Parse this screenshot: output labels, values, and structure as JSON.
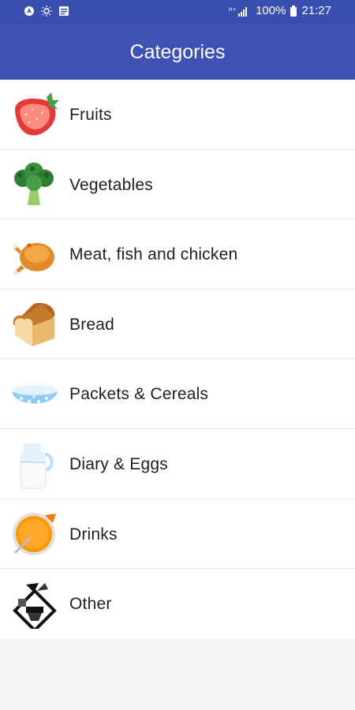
{
  "status_bar": {
    "battery": "100%",
    "time": "21:27",
    "icons": [
      "navigation-icon",
      "sun-icon",
      "message-icon",
      "signal-icon",
      "battery-icon"
    ]
  },
  "app_bar": {
    "title": "Categories"
  },
  "categories": [
    {
      "label": "Fruits",
      "icon": "strawberry-icon"
    },
    {
      "label": "Vegetables",
      "icon": "broccoli-icon"
    },
    {
      "label": "Meat, fish and chicken",
      "icon": "roast-chicken-icon"
    },
    {
      "label": "Bread",
      "icon": "bread-icon"
    },
    {
      "label": "Packets & Cereals",
      "icon": "cereal-bowl-icon"
    },
    {
      "label": "Diary & Eggs",
      "icon": "milk-jug-icon"
    },
    {
      "label": "Drinks",
      "icon": "orange-drink-icon"
    },
    {
      "label": "Other",
      "icon": "groceries-icon"
    }
  ],
  "colors": {
    "primary": "#3f51b5",
    "primary_dark": "#3a4db1",
    "background": "#f4f4f4"
  }
}
